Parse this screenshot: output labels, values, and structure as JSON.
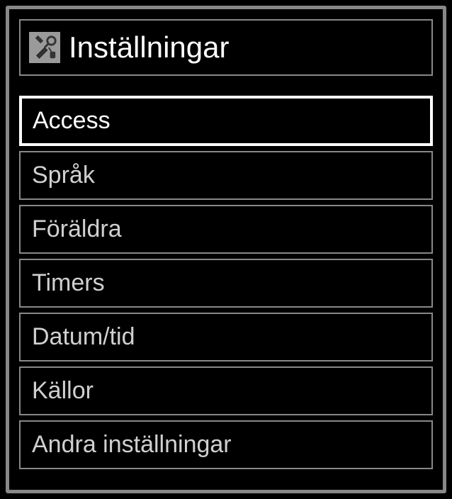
{
  "header": {
    "title": "Inställningar",
    "icon": "settings-tools-icon"
  },
  "menu": {
    "items": [
      {
        "label": "Access",
        "selected": true
      },
      {
        "label": "Språk",
        "selected": false
      },
      {
        "label": "Föräldra",
        "selected": false
      },
      {
        "label": "Timers",
        "selected": false
      },
      {
        "label": "Datum/tid",
        "selected": false
      },
      {
        "label": "Källor",
        "selected": false
      },
      {
        "label": "Andra inställningar",
        "selected": false
      }
    ]
  }
}
